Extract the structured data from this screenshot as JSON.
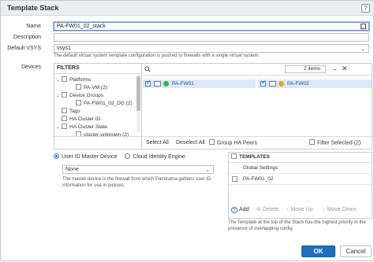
{
  "dialog": {
    "title": "Template Stack",
    "help_glyph": "?"
  },
  "form": {
    "name_label": "Name",
    "name_value": "PA-FW01_02_stack",
    "description_label": "Description",
    "description_value": "",
    "vsys_label": "Default VSYS",
    "vsys_value": "vsys1",
    "vsys_hint": "The default virtual system template configuration is pushed to firewalls with a single virtual system.",
    "devices_label": "Devices"
  },
  "filters": {
    "header": "FILTERS",
    "tree": [
      {
        "label": "Platforms",
        "level": 0,
        "expanded": true,
        "checked": false
      },
      {
        "label": "PA-VM (2)",
        "level": 1,
        "expanded": false,
        "checked": false
      },
      {
        "label": "Device Groups",
        "level": 0,
        "expanded": true,
        "checked": false
      },
      {
        "label": "PA-FW01_02_DG (2)",
        "level": 1,
        "expanded": false,
        "checked": false
      },
      {
        "label": "Tags",
        "level": 0,
        "expanded": false,
        "checked": false
      },
      {
        "label": "HA Cluster ID",
        "level": 0,
        "expanded": false,
        "checked": false
      },
      {
        "label": "HA Cluster State",
        "level": 0,
        "expanded": true,
        "checked": false
      },
      {
        "label": "cluster-unknown (2)",
        "level": 1,
        "expanded": false,
        "checked": false
      }
    ]
  },
  "device_list": {
    "items_count": "2 items",
    "devices": [
      {
        "name": "PA-FW01",
        "checked": true,
        "status_color": "#3cb043"
      },
      {
        "name": "PA-FW02",
        "checked": true,
        "status_color": "#e0a81c"
      }
    ],
    "footer": {
      "select_all": "Select All",
      "deselect_all": "Deselect All",
      "group_ha_peers": "Group HA Peers",
      "filter_selected": "Filter Selected (2)"
    }
  },
  "master": {
    "option_user_id": "User ID Master Device",
    "option_cloud": "Cloud Identity Engine",
    "selected_option": "user_id",
    "device_value": "None",
    "hint": "The master device is the firewall from which Panorama gathers user ID information for use in policies."
  },
  "templates": {
    "header": "TEMPLATES",
    "rows": [
      "Global Settings",
      "PA-FW01_02"
    ],
    "toolbar": {
      "add": "Add",
      "delete": "Delete",
      "move_up": "Move Up",
      "move_down": "Move Down"
    },
    "hint": "The Template at the top of the Stack has the highest priority in the presence of overlapping config"
  },
  "buttons": {
    "ok": "OK",
    "cancel": "Cancel"
  },
  "colors": {
    "accent": "#1f6dbd",
    "selected_row": "#dce8f6"
  }
}
